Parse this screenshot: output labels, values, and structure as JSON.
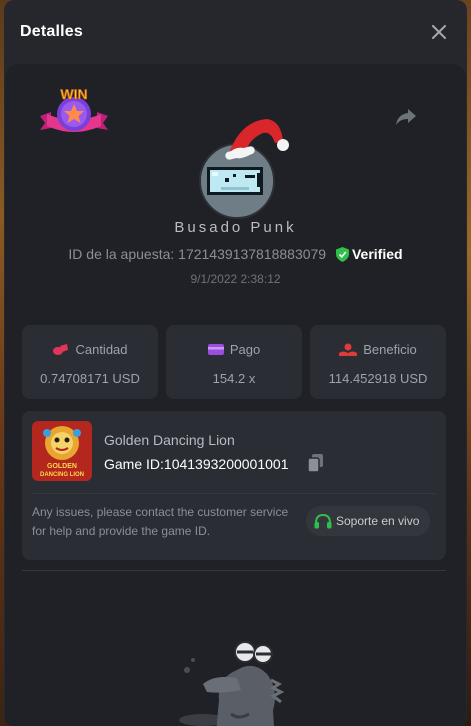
{
  "modal": {
    "title": "Detalles"
  },
  "player": {
    "username": "Busado Punk",
    "bet_id_label": "ID de la apuesta:",
    "bet_id": "1721439137818883079",
    "verified_label": "Verified",
    "date": "9/1/2022 2:38:12",
    "badge_text": "WIN"
  },
  "stats": [
    {
      "label": "Cantidad",
      "value": "0.74708171 USD",
      "icon": "coins-icon",
      "color": "#e2355a"
    },
    {
      "label": "Pago",
      "value": "154.2 x",
      "icon": "wallet-icon",
      "color": "#9b4de0"
    },
    {
      "label": "Beneficio",
      "value": "114.452918 USD",
      "icon": "profit-icon",
      "color": "#e03b3b"
    }
  ],
  "game": {
    "name": "Golden Dancing Lion",
    "id_label": "Game ID:",
    "id": "1041393200001001",
    "thumb_text_line1": "GOLDEN",
    "thumb_text_line2": "DANCING LION",
    "issues_text": "Any issues, please contact the customer service for help and provide the game ID.",
    "support_label": "Soporte en vivo"
  },
  "colors": {
    "verified": "#2fbf4a",
    "support_icon": "#2fbf4a",
    "accent_red": "#e2355a"
  }
}
